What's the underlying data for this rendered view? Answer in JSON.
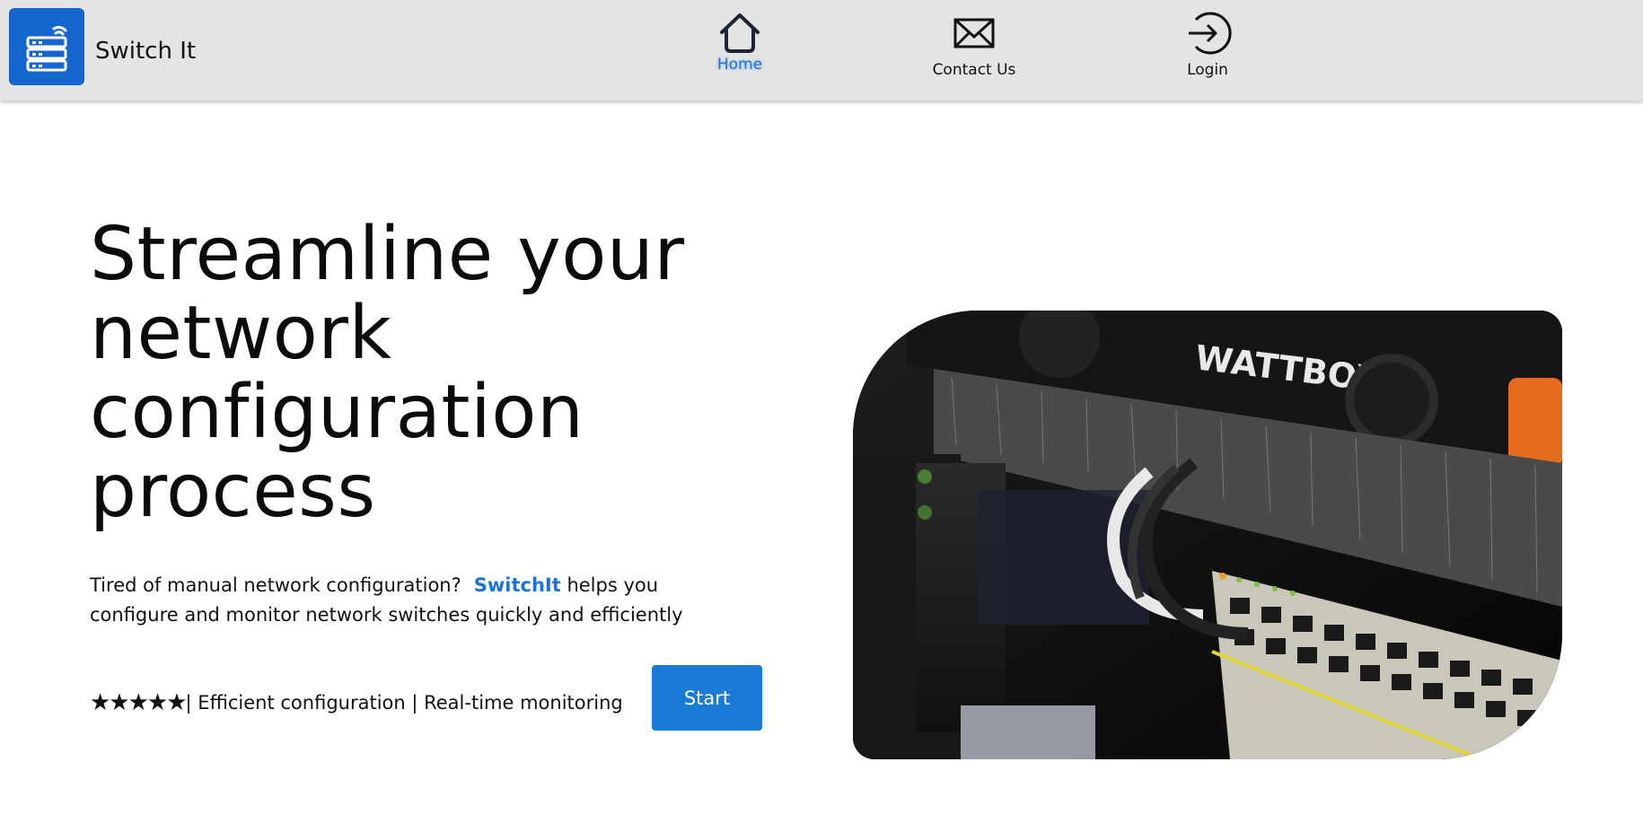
{
  "brand": {
    "name": "Switch It",
    "logo_icon": "network-switch-icon",
    "accent": "#1565cf"
  },
  "nav": [
    {
      "label": "Home",
      "icon": "home-icon",
      "active": true
    },
    {
      "label": "Contact Us",
      "icon": "envelope-icon",
      "active": false
    },
    {
      "label": "Login",
      "icon": "login-icon",
      "active": false
    }
  ],
  "hero": {
    "title": "Streamline your network configuration process",
    "desc_before": "Tired of manual network configuration?",
    "desc_brand": "SwitchIt",
    "desc_after": " helps you configure and monitor network switches quickly and efficiently",
    "stars": "★★★★★",
    "features_text": "| Efficient configuration | Real-time monitoring",
    "cta_label": "Start",
    "image_label": "WATTBOX"
  },
  "colors": {
    "accent_blue": "#1a73d9",
    "nav_bg": "#e4e4e4",
    "button_bg": "#1a7bd6"
  }
}
